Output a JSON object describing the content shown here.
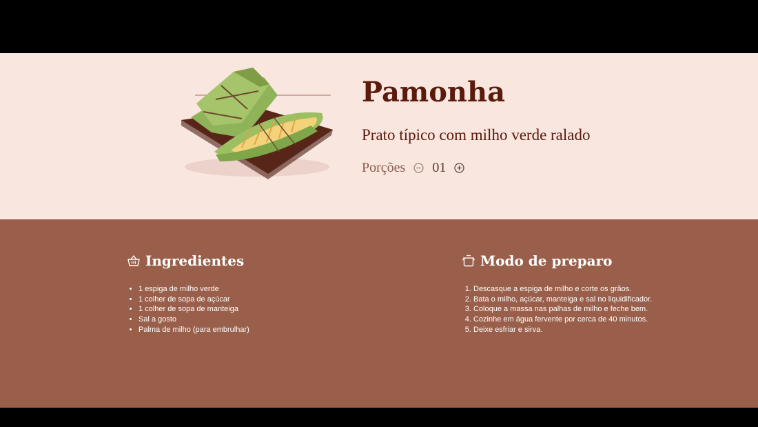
{
  "recipe": {
    "title": "Pamonha",
    "subtitle": "Prato típico com milho verde ralado",
    "image_icon": "pamonha-illustration"
  },
  "servings": {
    "label": "Porções",
    "value": "01",
    "decrement_icon": "minus-circle-icon",
    "increment_icon": "plus-circle-icon"
  },
  "ingredients": {
    "icon": "basket-icon",
    "title": "Ingredientes",
    "items": [
      "1 espiga de milho verde",
      "1 colher de sopa de açúcar",
      "1 colher de sopa de manteiga",
      "Sal a gosto",
      "Palma de milho (para embrulhar)"
    ]
  },
  "preparation": {
    "icon": "cooking-pot-icon",
    "title": "Modo de preparo",
    "steps": [
      "Descasque a espiga de milho e corte os grãos.",
      "Bata o milho, açúcar, manteiga e sal no liquidificador.",
      "Coloque a massa nas palhas de milho e feche bem.",
      "Cozinhe em água fervente por cerca de 40 minutos.",
      "Deixe esfriar e sirva."
    ]
  },
  "colors": {
    "hero_background": "#f8e6df",
    "content_background": "#9a5f4a",
    "title_color": "#5a1a0c",
    "letterbox": "#000000"
  }
}
